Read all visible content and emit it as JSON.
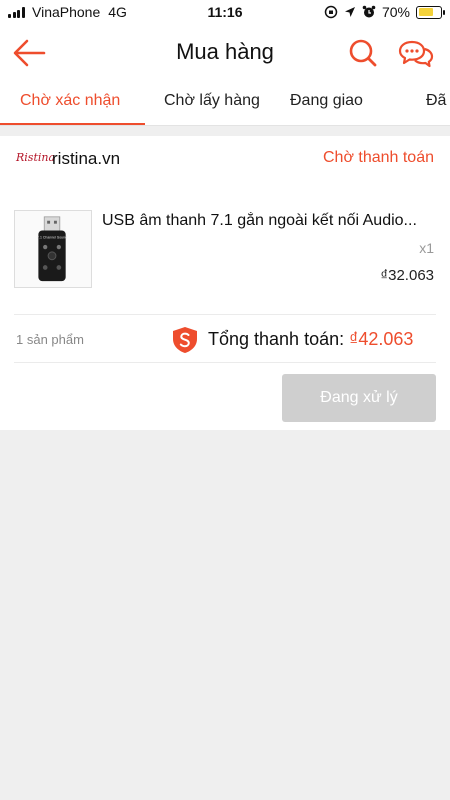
{
  "status_bar": {
    "carrier": "VinaPhone",
    "network": "4G",
    "time": "11:16",
    "battery": "70%",
    "battery_level": 0.7
  },
  "header": {
    "title": "Mua hàng",
    "back_icon": "arrow-left-icon",
    "search_icon": "search-icon",
    "chat_icon": "chat-icon"
  },
  "tabs": [
    {
      "label": "Chờ xác nhận",
      "active": true
    },
    {
      "label": "Chờ lấy hàng",
      "active": false
    },
    {
      "label": "Đang giao",
      "active": false
    },
    {
      "label": "Đã",
      "active": false
    }
  ],
  "order": {
    "shop_logo": "Ristina",
    "shop_name": "ristina.vn",
    "status": "Chờ thanh toán",
    "product": {
      "name": "USB âm thanh 7.1 gắn ngoài kết nối Audio...",
      "quantity": "x1",
      "price": "₫32.063",
      "thumb_label": "7.1 Channel Sound"
    },
    "item_count": "1 sản phẩm",
    "total_label": "Tổng thanh toán:",
    "total_value": "₫42.063",
    "action_button": "Đang xử lý"
  },
  "colors": {
    "accent": "#ee4d2d",
    "disabled_button": "#cfcfcf",
    "page_background": "#efefef"
  }
}
